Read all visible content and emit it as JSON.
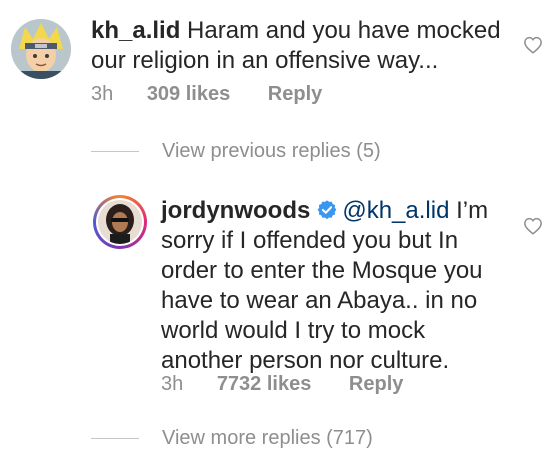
{
  "comments": [
    {
      "username": "kh_a.lid",
      "text": "Haram and you have mocked our religion in an offensive way...",
      "time": "3h",
      "likes": "309 likes",
      "reply_label": "Reply"
    },
    {
      "username": "jordynwoods",
      "mention": "@kh_a.lid",
      "text": "I’m sorry if I offended you but In order to enter the Mosque you have to wear an Abaya.. in no world would I try to mock another person nor culture.",
      "time": "3h",
      "likes": "7732 likes",
      "reply_label": "Reply"
    }
  ],
  "threads": {
    "previous": "View previous replies (5)",
    "more": "View more replies (717)"
  },
  "icons": {
    "like": "heart-icon",
    "verified": "verified-badge-icon"
  },
  "colors": {
    "text": "#262626",
    "meta": "#8e8e8e",
    "mention": "#003569",
    "verified": "#3897f0"
  }
}
